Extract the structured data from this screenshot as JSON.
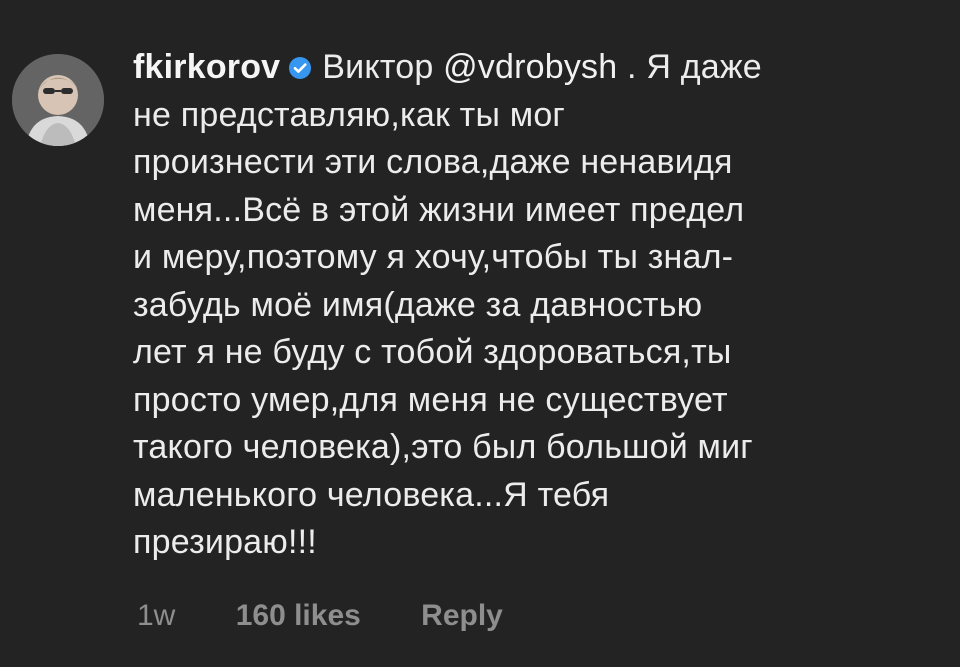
{
  "comment": {
    "username": "fkirkorov",
    "verified_icon": "verified-badge-icon",
    "greeting": "Виктор",
    "mention": "@vdrobysh",
    "line1_rest": " . Я даже",
    "lines": [
      "не представляю,как ты мог",
      "произнести эти слова,даже ненавидя",
      "меня...Всё в этой жизни имеет предел",
      "и меру,поэтому я хочу,чтобы ты знал-",
      "забудь моё имя(даже за давностью",
      "лет я не буду с тобой здороваться,ты",
      "просто умер,для меня не существует",
      "такого человека),это был большой миг",
      "маленького человека...Я тебя",
      "презираю!!!"
    ],
    "time": "1w",
    "likes": "160 likes",
    "reply_label": "Reply"
  },
  "colors": {
    "background": "#232323",
    "text": "#ececec",
    "secondary": "#8e8e8e",
    "verified_blue": "#3797f0"
  }
}
